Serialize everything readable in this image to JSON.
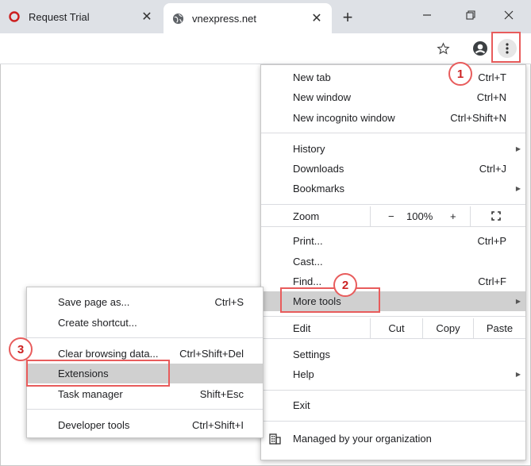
{
  "tabs": [
    {
      "title": "Request Trial",
      "icon": "brand-ring-icon",
      "active": false
    },
    {
      "title": "vnexpress.net",
      "icon": "globe-icon",
      "active": true
    }
  ],
  "window": {
    "minimize": "—",
    "maximize": "🗗",
    "close": "✕"
  },
  "menu": {
    "new_tab": {
      "label": "New tab",
      "shortcut": "Ctrl+T"
    },
    "new_window": {
      "label": "New window",
      "shortcut": "Ctrl+N"
    },
    "new_incognito": {
      "label": "New incognito window",
      "shortcut": "Ctrl+Shift+N"
    },
    "history": {
      "label": "History"
    },
    "downloads": {
      "label": "Downloads",
      "shortcut": "Ctrl+J"
    },
    "bookmarks": {
      "label": "Bookmarks"
    },
    "zoom": {
      "label": "Zoom",
      "minus": "−",
      "value": "100%",
      "plus": "+"
    },
    "print": {
      "label": "Print...",
      "shortcut": "Ctrl+P"
    },
    "cast": {
      "label": "Cast..."
    },
    "find": {
      "label": "Find...",
      "shortcut": "Ctrl+F"
    },
    "more_tools": {
      "label": "More tools"
    },
    "edit": {
      "label": "Edit",
      "cut": "Cut",
      "copy": "Copy",
      "paste": "Paste"
    },
    "settings": {
      "label": "Settings"
    },
    "help": {
      "label": "Help"
    },
    "exit": {
      "label": "Exit"
    },
    "managed": {
      "label": "Managed by your organization"
    }
  },
  "submenu": {
    "save_page": {
      "label": "Save page as...",
      "shortcut": "Ctrl+S"
    },
    "create_shortcut": {
      "label": "Create shortcut..."
    },
    "clear_data": {
      "label": "Clear browsing data...",
      "shortcut": "Ctrl+Shift+Del"
    },
    "extensions": {
      "label": "Extensions"
    },
    "task_manager": {
      "label": "Task manager",
      "shortcut": "Shift+Esc"
    },
    "dev_tools": {
      "label": "Developer tools",
      "shortcut": "Ctrl+Shift+I"
    }
  },
  "callouts": {
    "one": "1",
    "two": "2",
    "three": "3"
  },
  "colors": {
    "highlight": "#e85c5c",
    "callout_text": "#cc2222",
    "menu_hover": "#d0d0d0",
    "tabstrip": "#dee1e6"
  }
}
